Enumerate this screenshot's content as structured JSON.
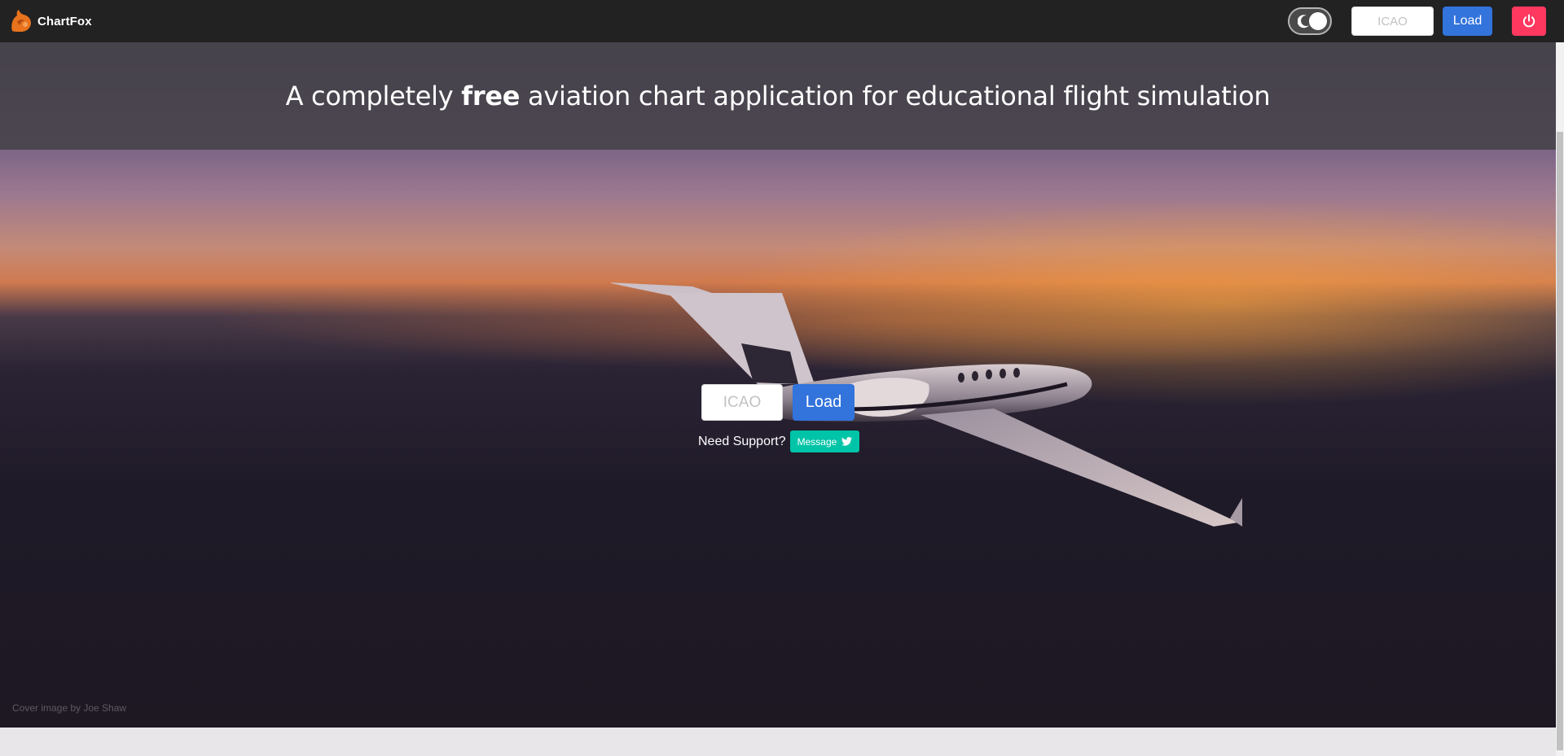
{
  "navbar": {
    "brand": "ChartFox",
    "icao_placeholder": "ICAO",
    "load_label": "Load"
  },
  "hero": {
    "heading_before": "A completely ",
    "heading_bold": "free",
    "heading_after": " aviation chart application for educational flight simulation",
    "icao_placeholder": "ICAO",
    "load_label": "Load",
    "support_text": "Need Support?",
    "message_label": "Message",
    "credit": "Cover image by Joe Shaw"
  },
  "colors": {
    "navbar_bg": "#222222",
    "primary": "#3273dc",
    "danger": "#ff3860",
    "message": "#00c4a7",
    "logo": "#e8731c"
  },
  "icons": [
    "fox-logo-icon",
    "moon-icon",
    "power-icon",
    "twitter-icon"
  ]
}
